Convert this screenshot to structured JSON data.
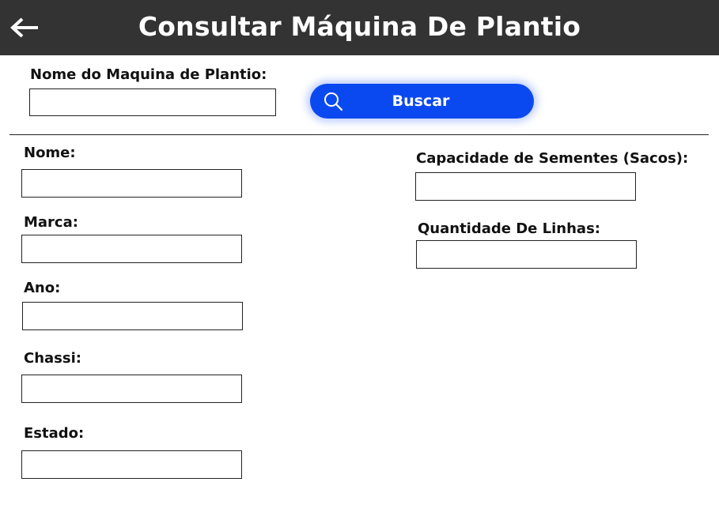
{
  "header": {
    "title": "Consultar Máquina De Plantio",
    "back_icon": "arrow-left-icon"
  },
  "search": {
    "label": "Nome do Maquina de Plantio:",
    "value": "",
    "button_label": "Buscar",
    "button_icon": "search-icon",
    "button_color": "#0b49f0"
  },
  "form": {
    "nome": {
      "label": "Nome:",
      "value": ""
    },
    "marca": {
      "label": "Marca:",
      "value": ""
    },
    "ano": {
      "label": "Ano:",
      "value": ""
    },
    "chassi": {
      "label": "Chassi:",
      "value": ""
    },
    "estado": {
      "label": "Estado:",
      "value": ""
    },
    "capacidade": {
      "label": "Capacidade de Sementes (Sacos):",
      "value": ""
    },
    "linhas": {
      "label": "Quantidade De Linhas:",
      "value": ""
    }
  },
  "colors": {
    "header_bg": "#333333",
    "button_bg": "#0b49f0"
  }
}
